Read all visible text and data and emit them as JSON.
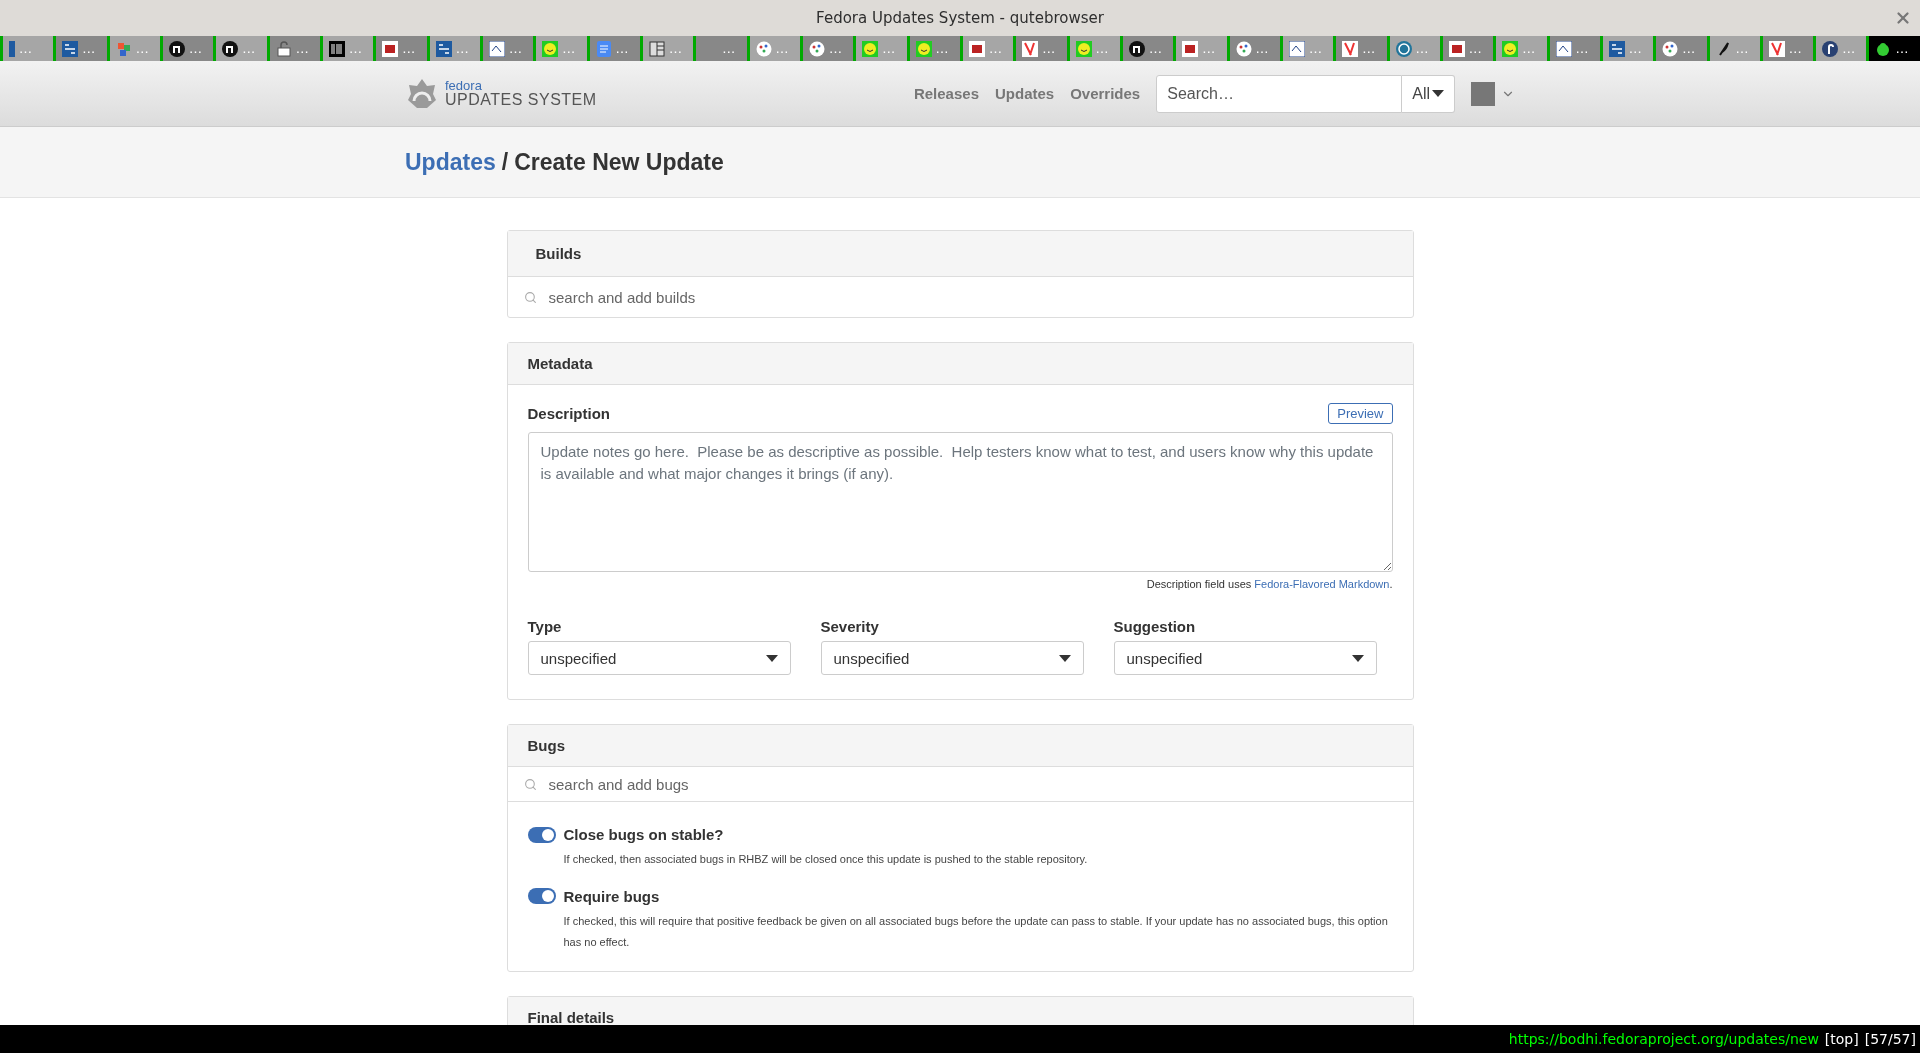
{
  "window": {
    "title": "Fedora Updates System - qutebrowser"
  },
  "tabs": [
    {
      "label": "…",
      "kind": "blue",
      "selected": false
    },
    {
      "label": "…",
      "kind": "pnas",
      "selected": false
    },
    {
      "label": "…",
      "kind": "color",
      "selected": false
    },
    {
      "label": "…",
      "kind": "n",
      "selected": false
    },
    {
      "label": "…",
      "kind": "n",
      "selected": false
    },
    {
      "label": "…",
      "kind": "lock",
      "selected": false
    },
    {
      "label": "…",
      "kind": "barcode",
      "selected": false
    },
    {
      "label": "…",
      "kind": "br",
      "selected": false
    },
    {
      "label": "…",
      "kind": "pnas",
      "selected": false
    },
    {
      "label": "…",
      "kind": "aps",
      "selected": false
    },
    {
      "label": "…",
      "kind": "smiley",
      "selected": false
    },
    {
      "label": "…",
      "kind": "docs",
      "selected": false
    },
    {
      "label": "…",
      "kind": "grid",
      "selected": false
    },
    {
      "label": "…",
      "kind": "blank",
      "selected": false
    },
    {
      "label": "…",
      "kind": "pie",
      "selected": false
    },
    {
      "label": "…",
      "kind": "pie",
      "selected": false
    },
    {
      "label": "…",
      "kind": "smiley",
      "selected": false
    },
    {
      "label": "…",
      "kind": "smiley",
      "selected": false
    },
    {
      "label": "…",
      "kind": "br",
      "selected": false
    },
    {
      "label": "…",
      "kind": "ribbon",
      "selected": false
    },
    {
      "label": "…",
      "kind": "smiley",
      "selected": false
    },
    {
      "label": "…",
      "kind": "n",
      "selected": false
    },
    {
      "label": "…",
      "kind": "br",
      "selected": false
    },
    {
      "label": "…",
      "kind": "pie",
      "selected": false
    },
    {
      "label": "…",
      "kind": "aps",
      "selected": false
    },
    {
      "label": "…",
      "kind": "ribbon",
      "selected": false
    },
    {
      "label": "…",
      "kind": "wordpress",
      "selected": false
    },
    {
      "label": "…",
      "kind": "br",
      "selected": false
    },
    {
      "label": "…",
      "kind": "smiley",
      "selected": false
    },
    {
      "label": "…",
      "kind": "aps",
      "selected": false
    },
    {
      "label": "…",
      "kind": "pnas",
      "selected": false
    },
    {
      "label": "…",
      "kind": "pie",
      "selected": false
    },
    {
      "label": "…",
      "kind": "feather",
      "selected": false
    },
    {
      "label": "…",
      "kind": "ribbon",
      "selected": false
    },
    {
      "label": "…",
      "kind": "fedora",
      "selected": false
    },
    {
      "label": "…",
      "kind": "flower",
      "selected": true
    }
  ],
  "navbar": {
    "logo": {
      "brand": "fedora",
      "product": "UPDATES SYSTEM"
    },
    "links": [
      "Releases",
      "Updates",
      "Overrides"
    ],
    "search": {
      "placeholder": "Search…"
    },
    "scope": "All"
  },
  "breadcrumb": {
    "parent": "Updates",
    "separator": "/",
    "current": "Create New Update"
  },
  "builds": {
    "title": "Builds",
    "search": {
      "placeholder": "search and add builds"
    }
  },
  "metadata": {
    "title": "Metadata",
    "description": {
      "label": "Description",
      "preview_button": "Preview",
      "placeholder": "Update notes go here.  Please be as descriptive as possible.  Help testers know what to test, and users know why this update is available and what major changes it brings (if any).",
      "help": "Description field uses ",
      "help_link": "Fedora-Flavored Markdown",
      "help_end": "."
    },
    "selects": [
      {
        "label": "Type",
        "value": "unspecified"
      },
      {
        "label": "Severity",
        "value": "unspecified"
      },
      {
        "label": "Suggestion",
        "value": "unspecified"
      }
    ]
  },
  "bugs": {
    "title": "Bugs",
    "search": {
      "placeholder": "search and add bugs"
    },
    "options": [
      {
        "label": "Close bugs on stable?",
        "help": "If checked, then associated bugs in RHBZ will be closed once this update is pushed to the stable repository.",
        "on": true
      },
      {
        "label": "Require bugs",
        "help": "If checked, this will require that positive feedback be given on all associated bugs before the update can pass to stable. If your update has no associated bugs, this option has no effect.",
        "on": true
      }
    ]
  },
  "final_details": {
    "title": "Final details"
  },
  "status_bar": {
    "url": "https://bodhi.fedoraproject.org/updates/new",
    "position": "[top]",
    "tab_index": "[57/57]"
  }
}
